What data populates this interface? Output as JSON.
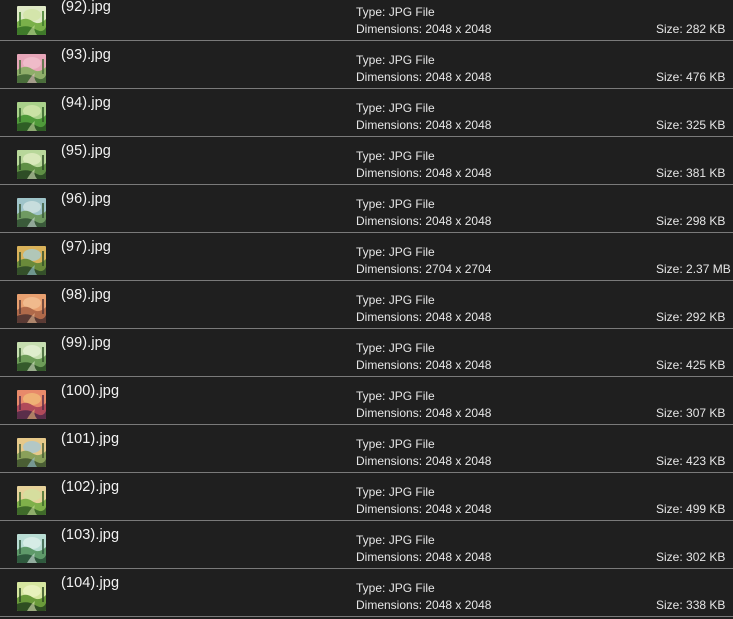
{
  "labels": {
    "type": "Type:",
    "dimensions": "Dimensions:",
    "size": "Size:"
  },
  "files": [
    {
      "name": "(92).jpg",
      "type": "JPG File",
      "dimensions": "2048 x 2048",
      "size": "282 KB",
      "thumb": {
        "sky": "#dfe9c6",
        "mid": "#7ab04a",
        "ground": "#3f7a2a",
        "accent": "#cfe3a0"
      }
    },
    {
      "name": "(93).jpg",
      "type": "JPG File",
      "dimensions": "2048 x 2048",
      "size": "476 KB",
      "thumb": {
        "sky": "#e7a6b9",
        "mid": "#8fae6a",
        "ground": "#4a6e3b",
        "accent": "#f2c4d0"
      }
    },
    {
      "name": "(94).jpg",
      "type": "JPG File",
      "dimensions": "2048 x 2048",
      "size": "325 KB",
      "thumb": {
        "sky": "#a9d18a",
        "mid": "#4f9a3a",
        "ground": "#2f5e25",
        "accent": "#d8eab0"
      }
    },
    {
      "name": "(95).jpg",
      "type": "JPG File",
      "dimensions": "2048 x 2048",
      "size": "381 KB",
      "thumb": {
        "sky": "#b8d79a",
        "mid": "#5f8f45",
        "ground": "#2e4d26",
        "accent": "#e5f0c8"
      }
    },
    {
      "name": "(96).jpg",
      "type": "JPG File",
      "dimensions": "2048 x 2048",
      "size": "298 KB",
      "thumb": {
        "sky": "#9fc4c9",
        "mid": "#6f9a62",
        "ground": "#3a5a3a",
        "accent": "#d9e8e6"
      }
    },
    {
      "name": "(97).jpg",
      "type": "JPG File",
      "dimensions": "2704 x 2704",
      "size": "2.37 MB",
      "thumb": {
        "sky": "#d9b25a",
        "mid": "#6a8a3a",
        "ground": "#34502a",
        "accent": "#9fd0e0"
      }
    },
    {
      "name": "(98).jpg",
      "type": "JPG File",
      "dimensions": "2048 x 2048",
      "size": "292 KB",
      "thumb": {
        "sky": "#e8a070",
        "mid": "#b06a4a",
        "ground": "#5a3a34",
        "accent": "#f4c59a"
      }
    },
    {
      "name": "(99).jpg",
      "type": "JPG File",
      "dimensions": "2048 x 2048",
      "size": "425 KB",
      "thumb": {
        "sky": "#c6deb0",
        "mid": "#6d9c58",
        "ground": "#355a2c",
        "accent": "#eaf3da"
      }
    },
    {
      "name": "(100).jpg",
      "type": "JPG File",
      "dimensions": "2048 x 2048",
      "size": "307 KB",
      "thumb": {
        "sky": "#e88a6a",
        "mid": "#b04a5a",
        "ground": "#5a2e4a",
        "accent": "#f2c27a"
      }
    },
    {
      "name": "(101).jpg",
      "type": "JPG File",
      "dimensions": "2048 x 2048",
      "size": "423 KB",
      "thumb": {
        "sky": "#e6c98a",
        "mid": "#8aa05a",
        "ground": "#4a5e34",
        "accent": "#9cc8e0"
      }
    },
    {
      "name": "(102).jpg",
      "type": "JPG File",
      "dimensions": "2048 x 2048",
      "size": "499 KB",
      "thumb": {
        "sky": "#e6d29a",
        "mid": "#7fb04a",
        "ground": "#3f6a2a",
        "accent": "#cfe3a0"
      }
    },
    {
      "name": "(103).jpg",
      "type": "JPG File",
      "dimensions": "2048 x 2048",
      "size": "302 KB",
      "thumb": {
        "sky": "#b9ddd4",
        "mid": "#5f9a6a",
        "ground": "#2f5a3e",
        "accent": "#e3f2ee"
      }
    },
    {
      "name": "(104).jpg",
      "type": "JPG File",
      "dimensions": "2048 x 2048",
      "size": "338 KB",
      "thumb": {
        "sky": "#d6e6a0",
        "mid": "#6a9a3a",
        "ground": "#2f4e22",
        "accent": "#f0f5c8"
      }
    }
  ]
}
